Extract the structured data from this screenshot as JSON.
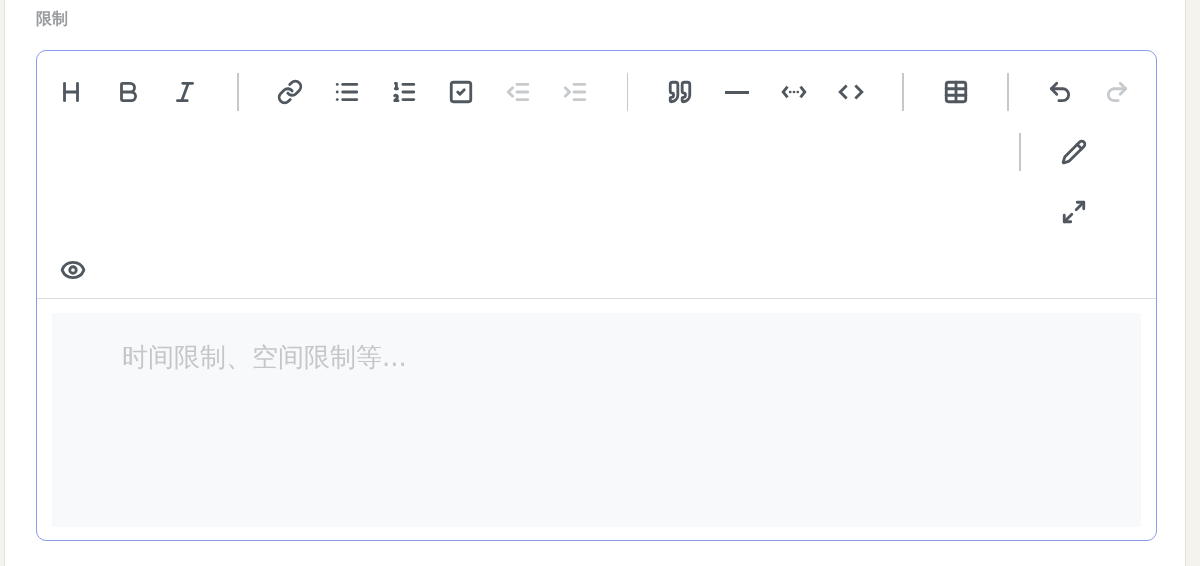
{
  "field": {
    "label": "限制"
  },
  "toolbar": [
    {
      "kind": "button",
      "disabled": false
    },
    {
      "kind": "button",
      "disabled": false
    },
    {
      "kind": "button",
      "disabled": false
    },
    {
      "kind": "separator"
    },
    {
      "kind": "button",
      "disabled": false
    },
    {
      "kind": "button",
      "disabled": false
    },
    {
      "kind": "button",
      "disabled": false
    },
    {
      "kind": "button",
      "disabled": false
    },
    {
      "kind": "button",
      "disabled": true
    },
    {
      "kind": "button",
      "disabled": true
    },
    {
      "kind": "separator"
    },
    {
      "kind": "button",
      "disabled": false
    },
    {
      "kind": "button",
      "disabled": false
    },
    {
      "kind": "button",
      "disabled": false
    },
    {
      "kind": "button",
      "disabled": false
    },
    {
      "kind": "separator"
    },
    {
      "kind": "button",
      "disabled": false
    },
    {
      "kind": "separator"
    },
    {
      "kind": "button",
      "disabled": false
    },
    {
      "kind": "button",
      "disabled": true
    },
    {
      "kind": "separator"
    },
    {
      "kind": "button",
      "disabled": false
    },
    {
      "kind": "button",
      "disabled": false
    },
    {
      "kind": "button",
      "disabled": false
    }
  ],
  "editor": {
    "placeholder": "时间限制、空间限制等..."
  }
}
